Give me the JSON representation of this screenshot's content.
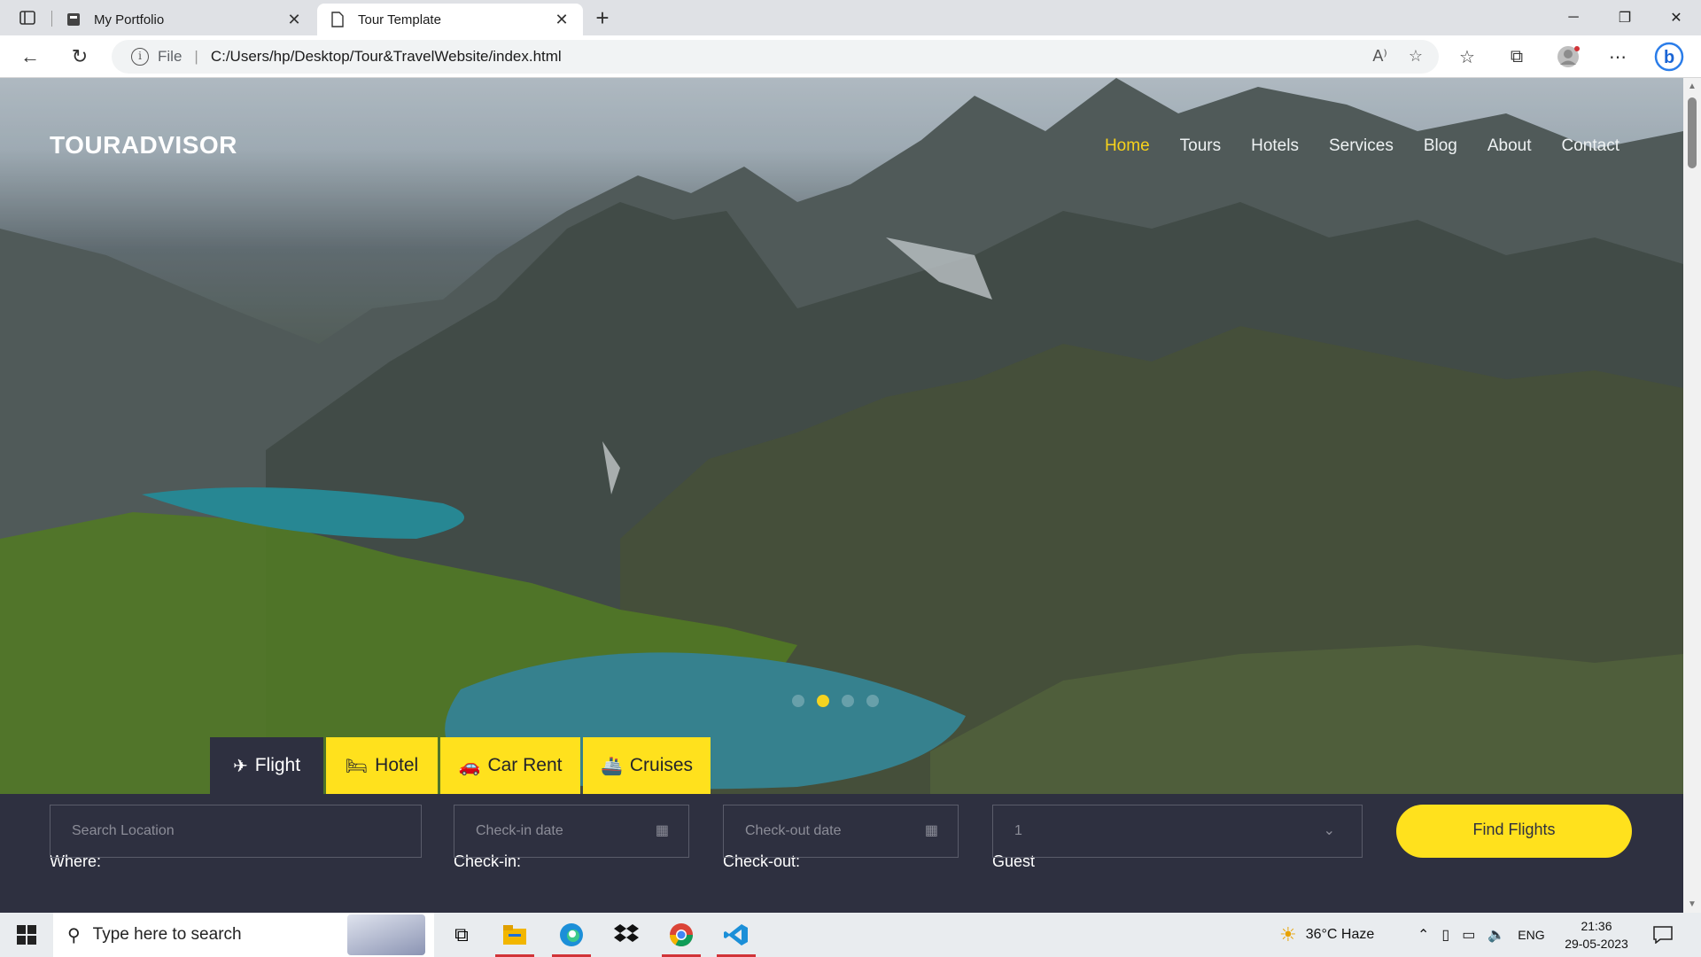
{
  "browser": {
    "tabs": [
      {
        "title": "My Portfolio",
        "active": false
      },
      {
        "title": "Tour Template",
        "active": true
      }
    ],
    "address": {
      "scheme": "File",
      "url": "C:/Users/hp/Desktop/Tour&TravelWebsite/index.html"
    }
  },
  "site": {
    "logo": "TOURADVISOR",
    "nav": [
      "Home",
      "Tours",
      "Hotels",
      "Services",
      "Blog",
      "About",
      "Contact"
    ],
    "active_nav": "Home",
    "accent_color": "#f7d21b",
    "panel_color": "#2e3040",
    "slider": {
      "count": 4,
      "active_index": 1
    },
    "booking_tabs": [
      {
        "label": "Flight",
        "icon": "plane-icon"
      },
      {
        "label": "Hotel",
        "icon": "hotel-icon"
      },
      {
        "label": "Car Rent",
        "icon": "car-icon"
      },
      {
        "label": "Cruises",
        "icon": "ship-icon"
      }
    ],
    "search": {
      "where_label": "Where:",
      "where_placeholder": "Search Location",
      "checkin_label": "Check-in:",
      "checkin_placeholder": "Check-in date",
      "checkout_label": "Check-out:",
      "checkout_placeholder": "Check-out date",
      "guest_label": "Guest",
      "guest_value": "1",
      "button": "Find Flights"
    }
  },
  "taskbar": {
    "search_placeholder": "Type here to search",
    "weather": "36°C Haze",
    "language": "ENG",
    "time": "21:36",
    "date": "29-05-2023"
  }
}
